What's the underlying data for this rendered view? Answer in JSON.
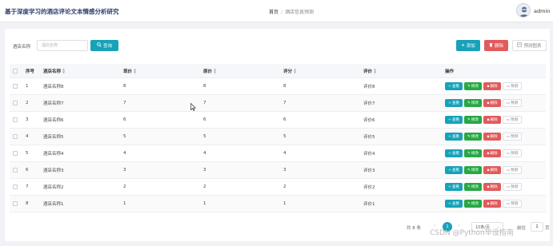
{
  "header": {
    "app_title": "基于深度学习的酒店评论文本情感分析研究",
    "breadcrumb_home": "首页",
    "breadcrumb_current": "酒店信息预测",
    "user_name": "admin"
  },
  "toolbar": {
    "search_label": "酒店名称",
    "search_placeholder": "酒店名称",
    "search_button": "查询",
    "add_button": "添加",
    "delete_button": "删除",
    "predict_chart_button": "预测图表"
  },
  "table": {
    "columns": [
      "序号",
      "酒店名称",
      "现价",
      "原价",
      "评分",
      "评价",
      "操作"
    ],
    "rows": [
      {
        "idx": "1",
        "name": "酒店名称8",
        "now": "8",
        "price": "8",
        "score": "8",
        "review": "评价8"
      },
      {
        "idx": "2",
        "name": "酒店名称7",
        "now": "7",
        "price": "7",
        "score": "7",
        "review": "评价7"
      },
      {
        "idx": "3",
        "name": "酒店名称6",
        "now": "6",
        "price": "6",
        "score": "6",
        "review": "评价6"
      },
      {
        "idx": "4",
        "name": "酒店名称5",
        "now": "5",
        "price": "5",
        "score": "5",
        "review": "评价5"
      },
      {
        "idx": "5",
        "name": "酒店名称4",
        "now": "4",
        "price": "4",
        "score": "4",
        "review": "评价4"
      },
      {
        "idx": "6",
        "name": "酒店名称3",
        "now": "3",
        "price": "3",
        "score": "3",
        "review": "评价3"
      },
      {
        "idx": "7",
        "name": "酒店名称2",
        "now": "2",
        "price": "2",
        "score": "2",
        "review": "评价2"
      },
      {
        "idx": "8",
        "name": "酒店名称1",
        "now": "1",
        "price": "1",
        "score": "1",
        "review": "评价1"
      }
    ],
    "row_actions": {
      "view": "查看",
      "edit": "修改",
      "delete": "删除",
      "predict": "预测"
    }
  },
  "pagination": {
    "total_text": "共 8 条",
    "current_page": "1",
    "page_size": "10条/页",
    "goto_label": "前往",
    "goto_value": "1",
    "page_unit": "页"
  },
  "watermark": "CSDN @Python毕设指南",
  "colors": {
    "primary": "#17a2b8",
    "success": "#28a745",
    "danger": "#e15b5b",
    "title": "#2b3b6c"
  }
}
